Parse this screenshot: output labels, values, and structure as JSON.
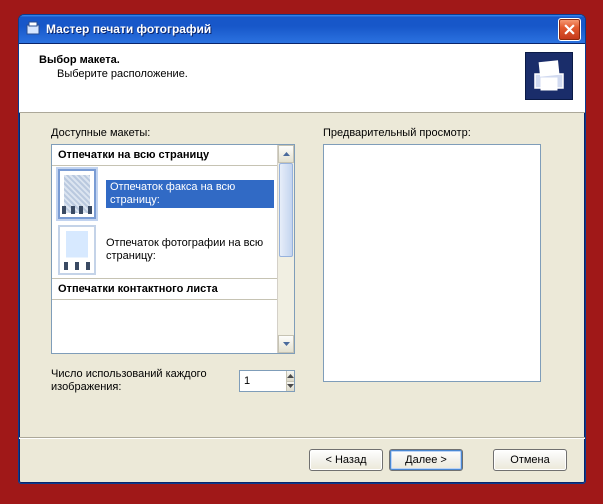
{
  "window": {
    "title": "Мастер печати фотографий"
  },
  "header": {
    "title": "Выбор макета.",
    "subtitle": "Выберите расположение."
  },
  "labels": {
    "available": "Доступные макеты:",
    "preview": "Предварительный просмотр:",
    "usage": "Число использований каждого изображения:"
  },
  "layouts": {
    "group1": "Отпечатки на всю страницу",
    "item1": "Отпечаток факса на всю страницу:",
    "item2": "Отпечаток фотографии на всю страницу:",
    "group2": "Отпечатки контактного листа"
  },
  "spinner": {
    "value": "1"
  },
  "buttons": {
    "back": "< Назад",
    "next": "Далее >",
    "cancel": "Отмена"
  }
}
